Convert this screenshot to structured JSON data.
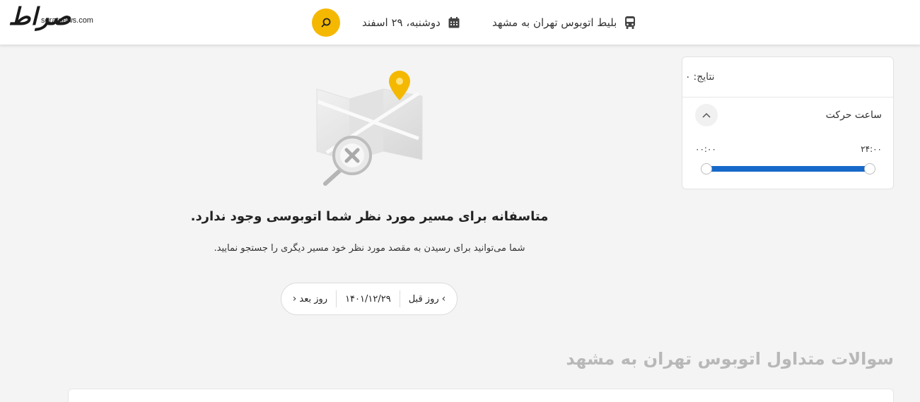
{
  "logo": {
    "glyph": "صراط",
    "site": "seratnews.com"
  },
  "header": {
    "route_label": "بلیط اتوبوس تهران به مشهد",
    "date_label": "دوشنبه، ۲۹ اسفند",
    "icons": {
      "route": "bus-icon",
      "date": "calendar-icon",
      "search": "search-icon"
    },
    "accent_color": "#f5b800"
  },
  "filters": {
    "results_label": "نتایج:",
    "results_count": "۰",
    "time_section_title": "ساعت حرکت",
    "time_min": "۰۰:۰۰",
    "time_max": "۲۴:۰۰",
    "slider_color": "#1769c9"
  },
  "empty_state": {
    "title": "متاسفانه برای مسیر مورد نظر شما اتوبوسی وجود ندارد.",
    "subtitle": "شما می‌توانید برای رسیدن به مقصد مورد نظر خود مسیر دیگری را جستجو نمایید."
  },
  "date_nav": {
    "prev_label": "روز قبل",
    "current_date": "۱۴۰۱/۱۲/۲۹",
    "next_label": "روز بعد"
  },
  "faq": {
    "title": "سوالات متداول اتوبوس تهران به مشهد"
  }
}
